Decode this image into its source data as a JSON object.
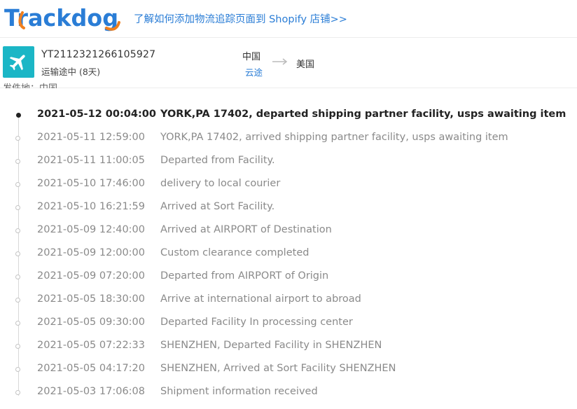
{
  "brand": {
    "name": "Trackdog"
  },
  "header": {
    "promo_link": "了解如何添加物流追踪页面到 Shopify 店铺>>"
  },
  "shipment": {
    "carrier_icon": "airplane-icon",
    "tracking_number": "YT2112321266105927",
    "status": "运输途中 (8天)",
    "origin_country": "中国",
    "origin_carrier": "云途",
    "destination_country": "美国",
    "origin_line": "发件地：中国"
  },
  "colors": {
    "accent_blue": "#2a7dd6",
    "logo_orange": "#f07f1e",
    "carrier_teal": "#1bb6c6"
  },
  "events": [
    {
      "time": "2021-05-12 00:04:00",
      "description": "YORK,PA 17402, departed shipping partner facility, usps awaiting item"
    },
    {
      "time": "2021-05-11 12:59:00",
      "description": "YORK,PA 17402, arrived shipping partner facility, usps awaiting item"
    },
    {
      "time": "2021-05-11 11:00:05",
      "description": "Departed from Facility."
    },
    {
      "time": "2021-05-10 17:46:00",
      "description": "delivery to local courier"
    },
    {
      "time": "2021-05-10 16:21:59",
      "description": "Arrived at Sort Facility."
    },
    {
      "time": "2021-05-09 12:40:00",
      "description": "Arrived at AIRPORT of Destination"
    },
    {
      "time": "2021-05-09 12:00:00",
      "description": "Custom clearance completed"
    },
    {
      "time": "2021-05-09 07:20:00",
      "description": "Departed from AIRPORT of Origin"
    },
    {
      "time": "2021-05-05 18:30:00",
      "description": "Arrive at international airport to abroad"
    },
    {
      "time": "2021-05-05 09:30:00",
      "description": "Departed Facility In processing center"
    },
    {
      "time": "2021-05-05 07:22:33",
      "description": "SHENZHEN, Departed Facility in SHENZHEN"
    },
    {
      "time": "2021-05-05 04:17:20",
      "description": "SHENZHEN, Arrived at Sort Facility SHENZHEN"
    },
    {
      "time": "2021-05-03 17:06:08",
      "description": "Shipment information received"
    }
  ]
}
